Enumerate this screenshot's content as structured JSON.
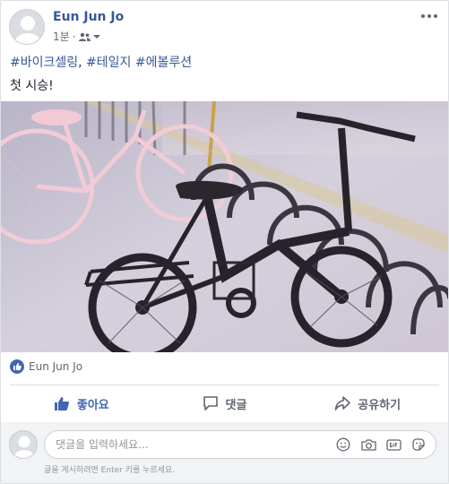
{
  "post": {
    "author": "Eun Jun Jo",
    "time": "1분",
    "separator": "·",
    "hashtags": [
      "#바이크셀링",
      "#테일지",
      "#에볼루션"
    ],
    "caption": "첫 시승!"
  },
  "reactions": {
    "names": "Eun Jun Jo"
  },
  "actions": {
    "like": "좋아요",
    "comment": "댓글",
    "share": "공유하기"
  },
  "comment_box": {
    "placeholder": "댓글을 입력하세요...",
    "hint": "글을 게시하려면 Enter 키를 누르세요."
  },
  "colors": {
    "brand": "#4267b2",
    "link": "#365899",
    "muted": "#606770"
  },
  "icons": {
    "more": "more-options-icon",
    "audience": "friends-icon",
    "like": "thumbs-up-icon",
    "comment": "speech-bubble-icon",
    "share": "share-arrow-icon",
    "emoji": "smiley-icon",
    "camera": "camera-icon",
    "gif": "gif-icon",
    "sticker": "sticker-icon"
  }
}
